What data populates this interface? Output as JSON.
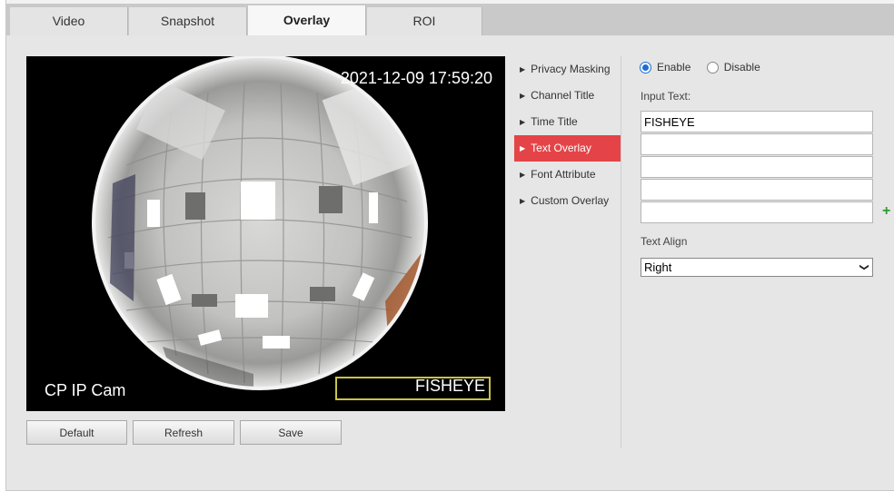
{
  "tabs": [
    {
      "label": "Video"
    },
    {
      "label": "Snapshot"
    },
    {
      "label": "Overlay"
    },
    {
      "label": "ROI"
    }
  ],
  "video": {
    "timestamp": "2021-12-09 17:59:20",
    "channel_title": "CP IP Cam",
    "overlay_text": "FISHEYE"
  },
  "buttons": {
    "default": "Default",
    "refresh": "Refresh",
    "save": "Save"
  },
  "menu": [
    {
      "label": "Privacy Masking"
    },
    {
      "label": "Channel Title"
    },
    {
      "label": "Time Title"
    },
    {
      "label": "Text Overlay"
    },
    {
      "label": "Font Attribute"
    },
    {
      "label": "Custom Overlay"
    }
  ],
  "settings": {
    "enable_label": "Enable",
    "disable_label": "Disable",
    "input_text_label": "Input Text:",
    "inputs": [
      "FISHEYE",
      "",
      "",
      "",
      ""
    ],
    "text_align_label": "Text Align",
    "text_align_value": "Right"
  },
  "colors": {
    "menu_active": "#e44447",
    "radio_selected": "#1b6fd1",
    "add_icon": "#2e9b2e",
    "osd_box": "#c8c34a"
  }
}
